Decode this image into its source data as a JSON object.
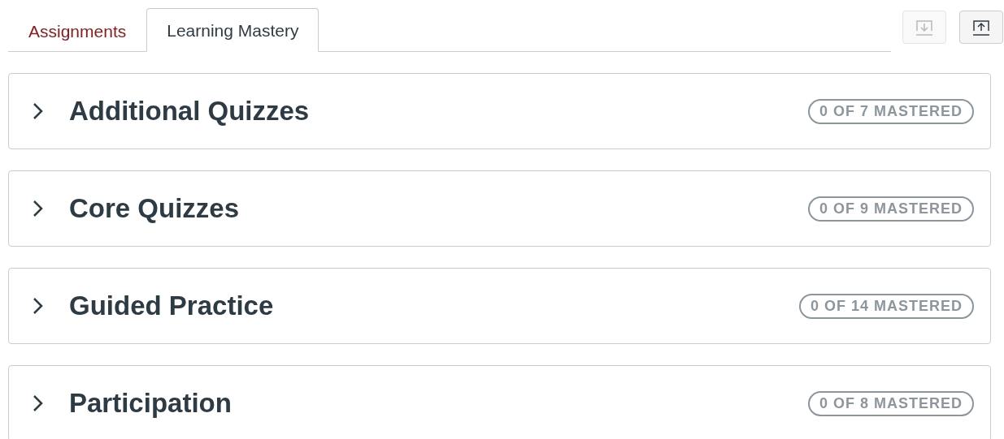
{
  "tabs": [
    {
      "label": "Assignments",
      "selected": false
    },
    {
      "label": "Learning Mastery",
      "selected": true
    }
  ],
  "toolbar": [
    {
      "kind": "download",
      "disabled": true
    },
    {
      "kind": "upload",
      "disabled": false
    }
  ],
  "groups": [
    {
      "title": "Additional Quizzes",
      "badge": "0 OF 7 MASTERED",
      "expanded": false
    },
    {
      "title": "Core Quizzes",
      "badge": "0 OF 9 MASTERED",
      "expanded": false
    },
    {
      "title": "Guided Practice",
      "badge": "0 OF 14 MASTERED",
      "expanded": false
    },
    {
      "title": "Participation",
      "badge": "0 OF 8 MASTERED",
      "expanded": false
    }
  ]
}
